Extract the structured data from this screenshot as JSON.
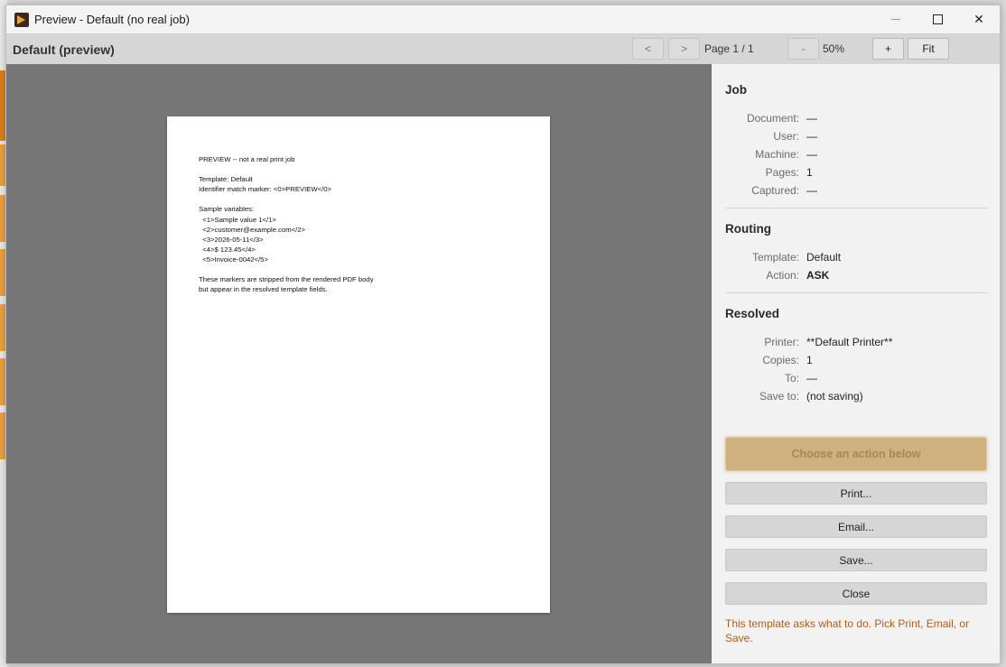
{
  "window": {
    "title": "Preview - Default (no real job)",
    "controls": {
      "minimize": "minimize-icon",
      "maximize": "maximize-icon",
      "close_glyph": "✕"
    }
  },
  "toolbar": {
    "title": "Default (preview)",
    "prev": "<",
    "next": ">",
    "page_label": "Page 1 / 1",
    "zoom_out": "-",
    "zoom_level": "50%",
    "zoom_in": "+",
    "fit": "Fit"
  },
  "document": {
    "text": "PREVIEW -- not a real print job\n\nTemplate: Default\nIdentifier match marker: <0>PREVIEW</0>\n\nSample variables:\n  <1>Sample value 1</1>\n  <2>customer@example.com</2>\n  <3>2026-05-11</3>\n  <4>$ 123.45</4>\n  <5>Invoice-0042</5>\n\nThese markers are stripped from the rendered PDF body\nbut appear in the resolved template fields."
  },
  "job": {
    "heading": "Job",
    "rows": [
      {
        "k": "Document:",
        "v": "—"
      },
      {
        "k": "User:",
        "v": "—"
      },
      {
        "k": "Machine:",
        "v": "—"
      },
      {
        "k": "Pages:",
        "v": "1"
      },
      {
        "k": "Captured:",
        "v": "—"
      }
    ]
  },
  "routing": {
    "heading": "Routing",
    "rows": [
      {
        "k": "Template:",
        "v": "Default"
      },
      {
        "k": "Action:",
        "v": "ASK"
      }
    ]
  },
  "resolved": {
    "heading": "Resolved",
    "rows": [
      {
        "k": "Printer:",
        "v": "**Default Printer**"
      },
      {
        "k": "Copies:",
        "v": "1"
      },
      {
        "k": "To:",
        "v": "—"
      },
      {
        "k": "Save to:",
        "v": "(not saving)"
      }
    ]
  },
  "actions": {
    "prompt": "Choose an action below",
    "print": "Print...",
    "email": "Email...",
    "save": "Save...",
    "close": "Close",
    "hint": "This template asks what to do.  Pick Print, Email, or Save."
  },
  "colors": {
    "preview_bg": "#767676",
    "cta_bg": "#cfb07f",
    "hint_text": "#b25e16"
  }
}
